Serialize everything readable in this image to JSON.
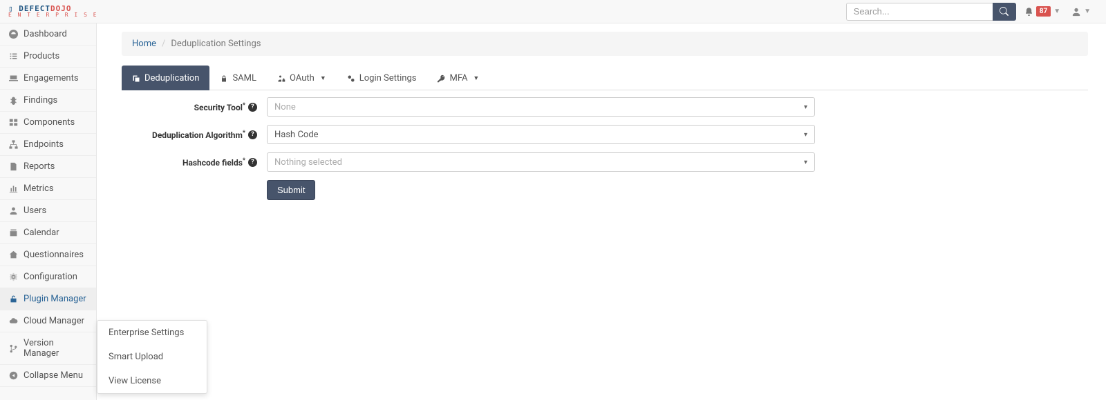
{
  "header": {
    "search_placeholder": "Search...",
    "notification_count": "87"
  },
  "sidebar": {
    "items": [
      {
        "label": "Dashboard"
      },
      {
        "label": "Products"
      },
      {
        "label": "Engagements"
      },
      {
        "label": "Findings"
      },
      {
        "label": "Components"
      },
      {
        "label": "Endpoints"
      },
      {
        "label": "Reports"
      },
      {
        "label": "Metrics"
      },
      {
        "label": "Users"
      },
      {
        "label": "Calendar"
      },
      {
        "label": "Questionnaires"
      },
      {
        "label": "Configuration"
      },
      {
        "label": "Plugin Manager"
      },
      {
        "label": "Cloud Manager"
      },
      {
        "label": "Version Manager"
      },
      {
        "label": "Collapse Menu"
      }
    ]
  },
  "flyout": {
    "items": [
      {
        "label": "Enterprise Settings"
      },
      {
        "label": "Smart Upload"
      },
      {
        "label": "View License"
      }
    ]
  },
  "breadcrumb": {
    "home": "Home",
    "current": "Deduplication Settings"
  },
  "tabs": {
    "items": [
      {
        "label": "Deduplication"
      },
      {
        "label": "SAML"
      },
      {
        "label": "OAuth"
      },
      {
        "label": "Login Settings"
      },
      {
        "label": "MFA"
      }
    ]
  },
  "form": {
    "security_tool": {
      "label": "Security Tool",
      "value": "None"
    },
    "dedup_algo": {
      "label": "Deduplication Algorithm",
      "value": "Hash Code"
    },
    "hashcode_fields": {
      "label": "Hashcode fields",
      "value": "Nothing selected"
    },
    "submit": "Submit"
  }
}
